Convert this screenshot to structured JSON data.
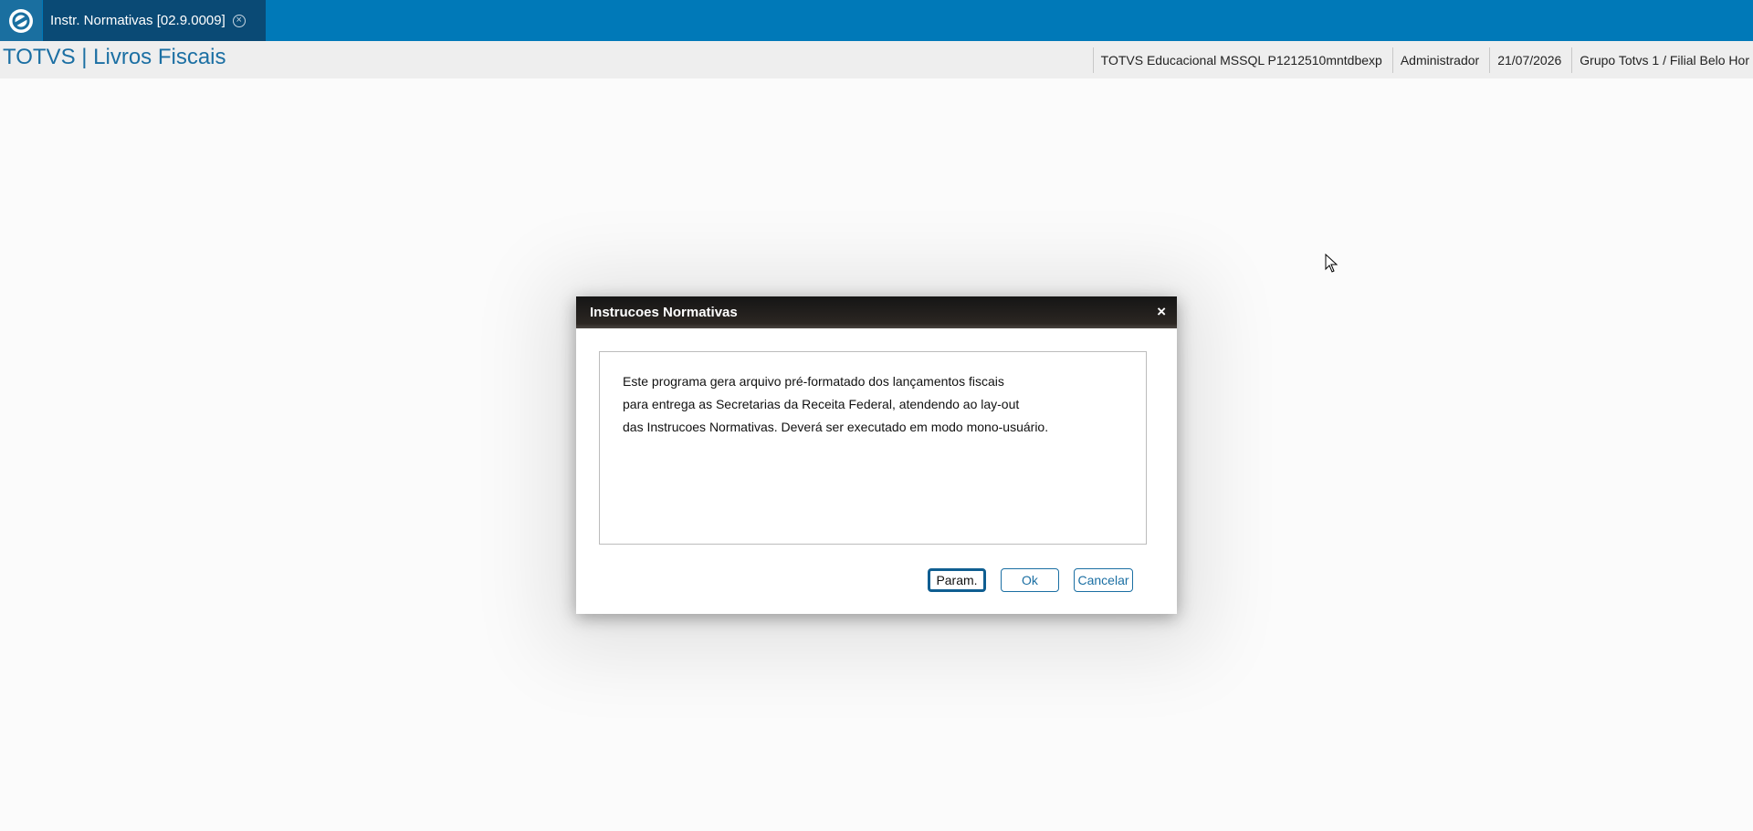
{
  "topbar": {
    "tab_label": "Instr. Normativas [02.9.0009]"
  },
  "header": {
    "app_title": "TOTVS | Livros Fiscais",
    "environment": "TOTVS Educacional MSSQL P1212510mntdbexp",
    "user": "Administrador",
    "date": "21/07/2026",
    "branch": "Grupo Totvs 1 / Filial Belo Hor"
  },
  "dialog": {
    "title": "Instrucoes Normativas",
    "close_glyph": "×",
    "description_lines": [
      "Este programa gera arquivo pré-formatado dos lançamentos fiscais",
      "para entrega as Secretarias da Receita Federal, atendendo ao lay-out",
      "das Instrucoes Normativas. Deverá ser executado em modo mono-usuário."
    ],
    "buttons": {
      "param": "Param.",
      "ok": "Ok",
      "cancel": "Cancelar"
    }
  },
  "colors": {
    "topbar": "#0079b8",
    "tab_active": "#0a4a75",
    "accent": "#1b6fa3"
  }
}
